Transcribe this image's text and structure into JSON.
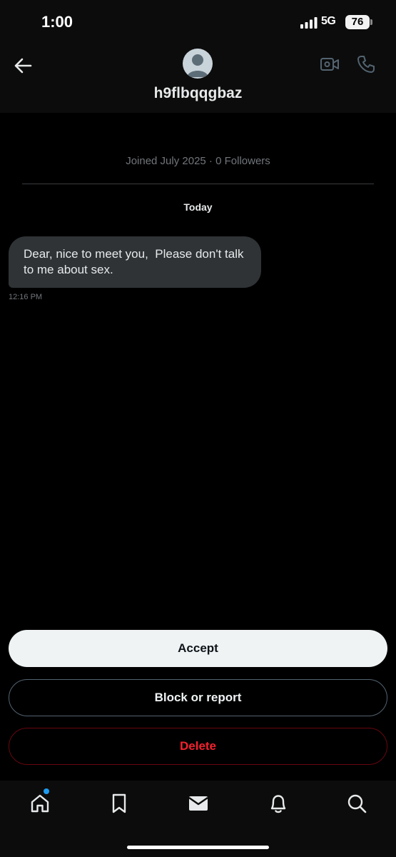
{
  "status_bar": {
    "time": "1:00",
    "network": "5G",
    "battery": "76"
  },
  "header": {
    "username": "h9flbqqgbaz",
    "icons": [
      "back-arrow-icon",
      "avatar",
      "video-call-icon",
      "phone-call-icon"
    ]
  },
  "profile": {
    "meta": "Joined July 2025 · 0 Followers"
  },
  "conversation": {
    "date_separator": "Today",
    "messages": [
      {
        "text": "Dear, nice to meet you,  Please don't talk to me about sex.",
        "time": "12:16 PM",
        "direction": "incoming"
      }
    ]
  },
  "actions": {
    "accept": "Accept",
    "block_or_report": "Block or report",
    "delete": "Delete"
  },
  "bottom_nav": {
    "items": [
      "home-icon",
      "bookmark-icon",
      "messages-icon",
      "notifications-icon",
      "search-icon"
    ],
    "home_has_notification": true
  },
  "colors": {
    "accent": "#1d9bf0",
    "danger": "#f4212e",
    "bubble": "#2f3336",
    "muted_text": "#71767b"
  }
}
